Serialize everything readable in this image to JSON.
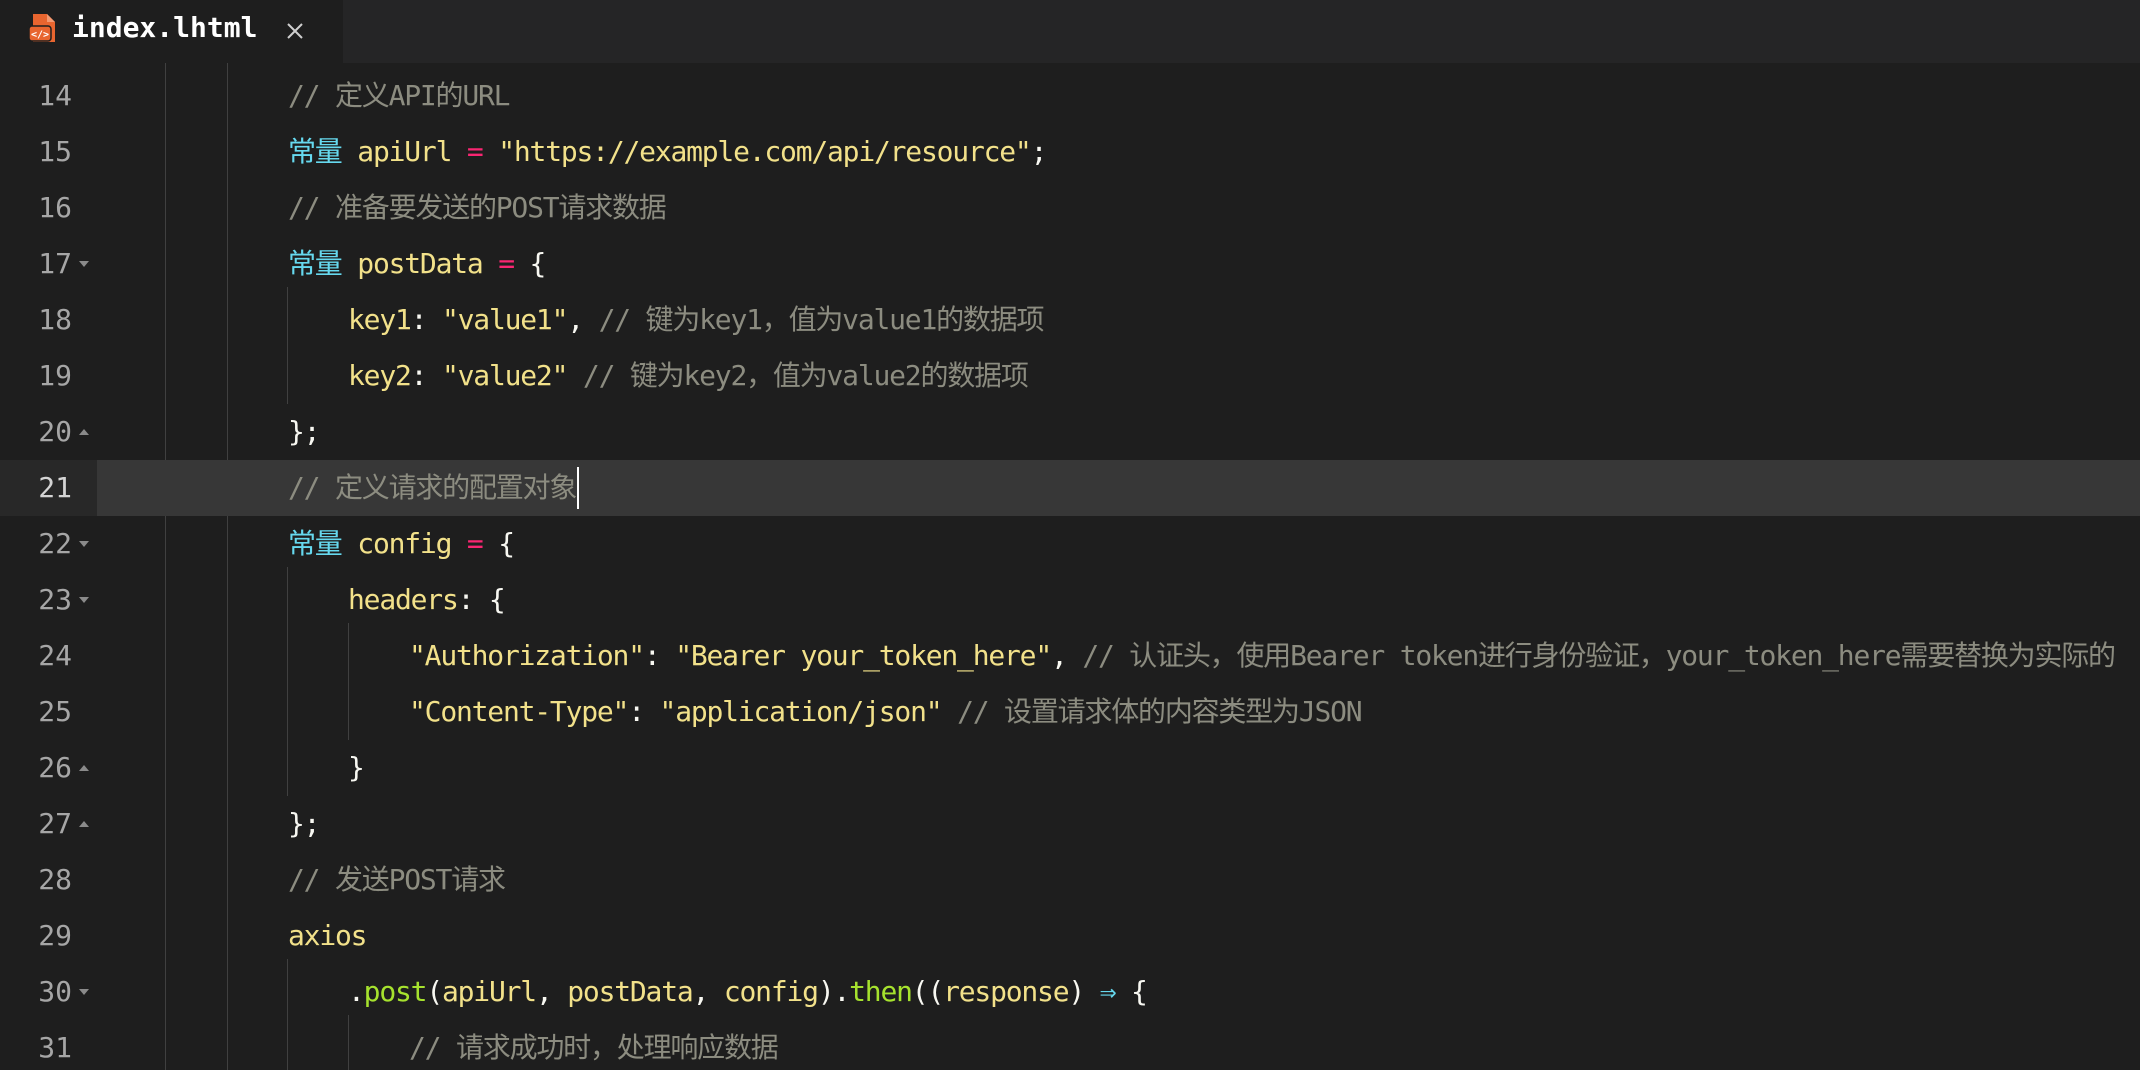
{
  "tab": {
    "filename": "index.lhtml",
    "icon": "html-file-icon",
    "close": "close-icon"
  },
  "colors": {
    "background": "#1e1e1e",
    "current_line": "#373737",
    "keyword": "#66d9ef",
    "variable": "#f2e18a",
    "operator": "#f92672",
    "function": "#a6e22e",
    "comment": "#8c8c80"
  },
  "editor": {
    "current_line": "21",
    "lines": [
      {
        "number": "14",
        "fold": "",
        "tokens": [
          {
            "t": "// 定义API的URL",
            "k": "c"
          }
        ]
      },
      {
        "number": "15",
        "fold": "",
        "tokens": [
          {
            "t": "常量",
            "k": "k"
          },
          {
            "t": " ",
            "k": "p"
          },
          {
            "t": "apiUrl",
            "k": "v"
          },
          {
            "t": " = ",
            "k": "o"
          },
          {
            "t": "\"https://example.com/api/resource\"",
            "k": "s"
          },
          {
            "t": ";",
            "k": "p"
          }
        ]
      },
      {
        "number": "16",
        "fold": "",
        "tokens": [
          {
            "t": "// 准备要发送的POST请求数据",
            "k": "c"
          }
        ]
      },
      {
        "number": "17",
        "fold": "down",
        "tokens": [
          {
            "t": "常量",
            "k": "k"
          },
          {
            "t": " ",
            "k": "p"
          },
          {
            "t": "postData",
            "k": "v"
          },
          {
            "t": " = ",
            "k": "o"
          },
          {
            "t": "{",
            "k": "p"
          }
        ]
      },
      {
        "number": "18",
        "fold": "",
        "tokens": [
          {
            "t": "key1",
            "k": "v"
          },
          {
            "t": ": ",
            "k": "p"
          },
          {
            "t": "\"value1\"",
            "k": "s"
          },
          {
            "t": ", ",
            "k": "p"
          },
          {
            "t": "// 键为key1，值为value1的数据项",
            "k": "c"
          }
        ]
      },
      {
        "number": "19",
        "fold": "",
        "tokens": [
          {
            "t": "key2",
            "k": "v"
          },
          {
            "t": ": ",
            "k": "p"
          },
          {
            "t": "\"value2\"",
            "k": "s"
          },
          {
            "t": " ",
            "k": "p"
          },
          {
            "t": "// 键为key2，值为value2的数据项",
            "k": "c"
          }
        ]
      },
      {
        "number": "20",
        "fold": "up",
        "tokens": [
          {
            "t": "};",
            "k": "p"
          }
        ]
      },
      {
        "number": "21",
        "fold": "",
        "tokens": [
          {
            "t": "// 定义请求的配置对象",
            "k": "c"
          }
        ]
      },
      {
        "number": "22",
        "fold": "down",
        "tokens": [
          {
            "t": "常量",
            "k": "k"
          },
          {
            "t": " ",
            "k": "p"
          },
          {
            "t": "config",
            "k": "v"
          },
          {
            "t": " = ",
            "k": "o"
          },
          {
            "t": "{",
            "k": "p"
          }
        ]
      },
      {
        "number": "23",
        "fold": "down",
        "tokens": [
          {
            "t": "headers",
            "k": "v"
          },
          {
            "t": ": {",
            "k": "p"
          }
        ]
      },
      {
        "number": "24",
        "fold": "",
        "tokens": [
          {
            "t": "\"Authorization\"",
            "k": "s"
          },
          {
            "t": ": ",
            "k": "p"
          },
          {
            "t": "\"Bearer your_token_here\"",
            "k": "s"
          },
          {
            "t": ", ",
            "k": "p"
          },
          {
            "t": "// 认证头，使用Bearer token进行身份验证，your_token_here需要替换为实际的",
            "k": "c"
          }
        ]
      },
      {
        "number": "25",
        "fold": "",
        "tokens": [
          {
            "t": "\"Content-Type\"",
            "k": "s"
          },
          {
            "t": ": ",
            "k": "p"
          },
          {
            "t": "\"application/json\"",
            "k": "s"
          },
          {
            "t": " ",
            "k": "p"
          },
          {
            "t": "// 设置请求体的内容类型为JSON",
            "k": "c"
          }
        ]
      },
      {
        "number": "26",
        "fold": "up",
        "tokens": [
          {
            "t": "}",
            "k": "p"
          }
        ]
      },
      {
        "number": "27",
        "fold": "up",
        "tokens": [
          {
            "t": "};",
            "k": "p"
          }
        ]
      },
      {
        "number": "28",
        "fold": "",
        "tokens": [
          {
            "t": "// 发送POST请求",
            "k": "c"
          }
        ]
      },
      {
        "number": "29",
        "fold": "",
        "tokens": [
          {
            "t": "axios",
            "k": "v"
          }
        ]
      },
      {
        "number": "30",
        "fold": "down",
        "tokens": [
          {
            "t": ".",
            "k": "p"
          },
          {
            "t": "post",
            "k": "f"
          },
          {
            "t": "(",
            "k": "p"
          },
          {
            "t": "apiUrl",
            "k": "v"
          },
          {
            "t": ", ",
            "k": "p"
          },
          {
            "t": "postData",
            "k": "v"
          },
          {
            "t": ", ",
            "k": "p"
          },
          {
            "t": "config",
            "k": "v"
          },
          {
            "t": ").",
            "k": "p"
          },
          {
            "t": "then",
            "k": "f"
          },
          {
            "t": "((",
            "k": "p"
          },
          {
            "t": "response",
            "k": "v"
          },
          {
            "t": ") ",
            "k": "p"
          },
          {
            "t": "⇒",
            "k": "k"
          },
          {
            "t": " {",
            "k": "p"
          }
        ]
      },
      {
        "number": "31",
        "fold": "",
        "tokens": [
          {
            "t": "// 请求成功时，处理响应数据",
            "k": "c"
          }
        ]
      }
    ]
  }
}
